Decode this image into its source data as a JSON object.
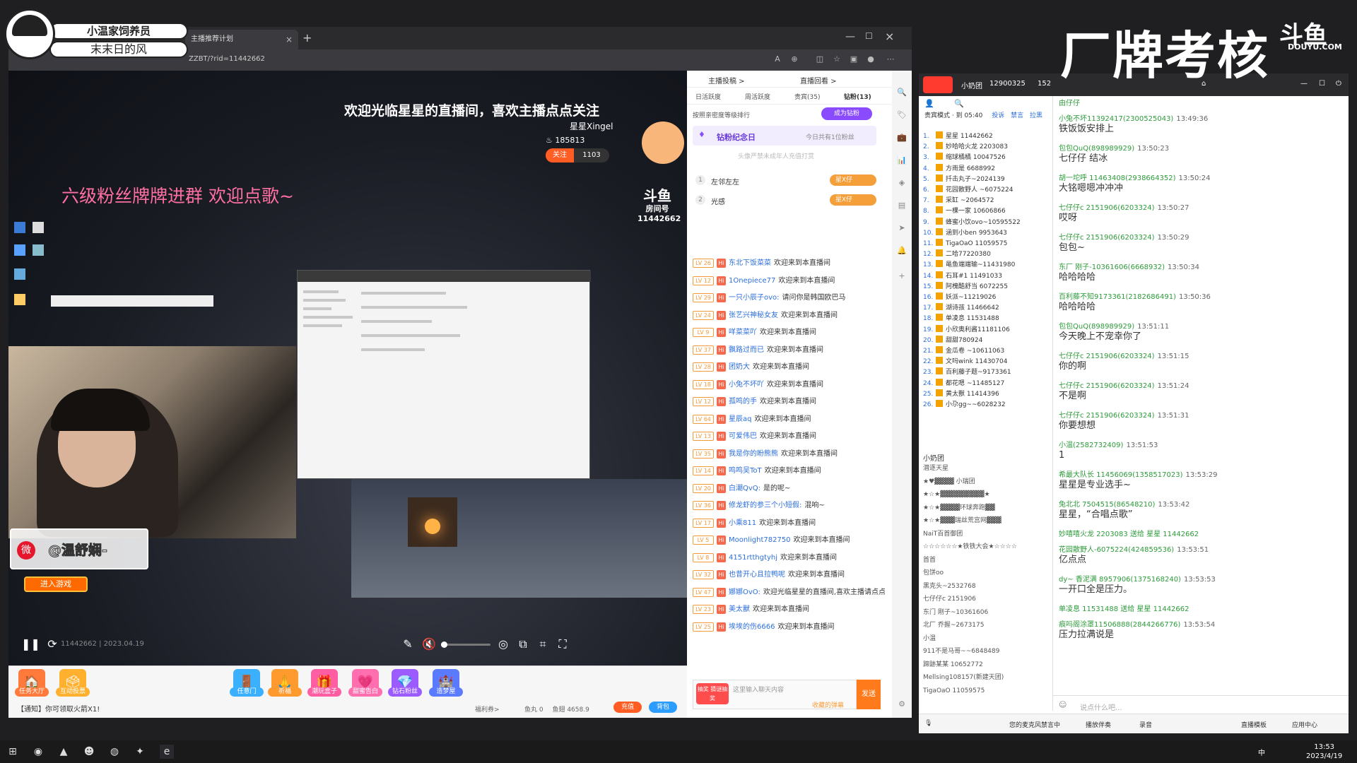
{
  "overlay": {
    "pet_title": "小温家饲养员",
    "pet_subtitle": "末末日的风"
  },
  "watermark": {
    "text": "厂牌考核",
    "site": "DOUYU.COM"
  },
  "browser": {
    "tab_title": "主播推荐计划",
    "url": "ZZBT/?rid=11442662",
    "new_tab": "+"
  },
  "player": {
    "welcome": "欢迎光临星星的直播间，喜欢主播点点关注",
    "anchor_name": "星星Xingel",
    "hot": "185813",
    "follow_label": "关注",
    "follow_count": "1103",
    "fan_text": "六级粉丝牌牌进群 欢迎点歌~",
    "room_logo": "斗鱼",
    "room_label": "房间号",
    "room_id": "11442662",
    "weibo": "@温舒娴-",
    "enter_game": "进入游戏",
    "room_ts": "11442662 | 2023.04.19",
    "volume": 0.05
  },
  "gifts": [
    {
      "name": "任务大厅",
      "icon": "🏠",
      "color": "#ff7a3b"
    },
    {
      "name": "互动投票",
      "icon": "🗳",
      "color": "#ffb02e"
    },
    {
      "name": "任意门",
      "icon": "🚪",
      "color": "#3bb0ff"
    },
    {
      "name": "祈福",
      "icon": "🙏",
      "color": "#ff9a2e"
    },
    {
      "name": "潮玩盒子",
      "icon": "🎁",
      "color": "#ff5fa2"
    },
    {
      "name": "甜蜜告白",
      "icon": "💗",
      "color": "#ff6fb0"
    },
    {
      "name": "钻石粉丝",
      "icon": "💎",
      "color": "#9b5bff"
    },
    {
      "name": "造梦屋",
      "icon": "🏰",
      "color": "#5b7bff"
    }
  ],
  "giftbar": {
    "notice": "【通知】你可领取火箭X1!",
    "welfare": "福利券>",
    "fish_pill": "鱼丸 0",
    "fish_ball": "鱼翅 4658.9",
    "recharge": "充值",
    "bag": "背包"
  },
  "chat": {
    "top_btn1": "主播投稿 >",
    "top_btn2": "直播回看 >",
    "tabs": [
      "日活跃度",
      "周活跃度",
      "贵宾(35)",
      "钻粉(13)"
    ],
    "rank_label": "按照亲密度等级排行",
    "become": "成为钻粉",
    "memorial_title": "钻粉纪念日",
    "memorial_note": "今日共有1位粉丝",
    "hint": "头像严禁未成年人充值打赏",
    "ranks": [
      {
        "no": "1",
        "name": "左邻左左",
        "badge": "星X仔"
      },
      {
        "no": "2",
        "name": "光感",
        "badge": "星X仔"
      }
    ],
    "messages": [
      {
        "lv": "LV 26",
        "user": "东北下饭菜菜",
        "text": "欢迎来到本直播间"
      },
      {
        "lv": "LV 12",
        "user": "1Onepiece77",
        "text": "欢迎来到本直播间"
      },
      {
        "lv": "LV 29",
        "user": "一只小辰子ovo:",
        "text": "请问你是韩国欧巴马"
      },
      {
        "lv": "LV 24",
        "user": "张艺兴神秘女友",
        "text": "欢迎来到本直播间"
      },
      {
        "lv": "LV 9",
        "user": "咩菜菜吖",
        "text": "欢迎来到本直播间"
      },
      {
        "lv": "LV 37",
        "user": "飘路过而已",
        "text": "欢迎来到本直播间"
      },
      {
        "lv": "LV 28",
        "user": "团奶大",
        "text": "欢迎来到本直播间"
      },
      {
        "lv": "LV 18",
        "user": "小兔不坏吖",
        "text": "欢迎来到本直播间"
      },
      {
        "lv": "LV 12",
        "user": "孤鸣的手",
        "text": "欢迎来到本直播间"
      },
      {
        "lv": "LV 64",
        "user": "星辰aq",
        "text": "欢迎来到本直播间"
      },
      {
        "lv": "LV 13",
        "user": "可爱伟巴",
        "text": "欢迎来到本直播间"
      },
      {
        "lv": "LV 35",
        "user": "我是你的盼熊熊",
        "text": "欢迎来到本直播间"
      },
      {
        "lv": "LV 14",
        "user": "鸣鸣吴ToT",
        "text": "欢迎来到本直播间"
      },
      {
        "lv": "LV 20",
        "user": "白潮QvQ:",
        "text": "是的呢~"
      },
      {
        "lv": "LV 36",
        "user": "修龙虾的参三个小短假:",
        "text": "混响~"
      },
      {
        "lv": "LV 17",
        "user": "小乘811",
        "text": "欢迎来到本直播间"
      },
      {
        "lv": "LV 5",
        "user": "Moonlight782750",
        "text": "欢迎来到本直播间"
      },
      {
        "lv": "LV 8",
        "user": "4151rtthgtyhj",
        "text": "欢迎来到本直播间"
      },
      {
        "lv": "LV 32",
        "user": "也昔开心且拉鸭呢",
        "text": "欢迎来到本直播间"
      },
      {
        "lv": "LV 47",
        "user": "娜娜OvO:",
        "text": "欢迎光临星星的直播间,喜欢主播请点点关注~"
      },
      {
        "lv": "LV 23",
        "user": "美太獸",
        "text": "欢迎来到本直播间"
      },
      {
        "lv": "LV 25",
        "user": "埃埃的伤6666",
        "text": "欢迎来到本直播间"
      }
    ],
    "input_placeholder": "这里输入聊天内容",
    "barrage": "收藏的弹幕",
    "send": "发送",
    "lottery": "抽奖 猜谜抽奖"
  },
  "tool": {
    "title": "小奶团",
    "room": "12900325",
    "viewers": "152",
    "users_mode": "贵宾模式 · 到 05:40",
    "users_actions": [
      "投诉",
      "禁言",
      "拉黑"
    ],
    "users": [
      {
        "no": "1.",
        "name": "星星 11442662"
      },
      {
        "no": "2.",
        "name": "妙哈哈火龙 2203083"
      },
      {
        "no": "3.",
        "name": "缩球橘橘 10047526"
      },
      {
        "no": "4.",
        "name": "方雨是 6688992"
      },
      {
        "no": "5.",
        "name": "扦击丸子~2024139"
      },
      {
        "no": "6.",
        "name": "花园散野人 ~6075224"
      },
      {
        "no": "7.",
        "name": "采缸 ~2064572"
      },
      {
        "no": "8.",
        "name": "一棵一家 10606866"
      },
      {
        "no": "9.",
        "name": "蜂蜜小饮ovo~10595522"
      },
      {
        "no": "10.",
        "name": "涵到小ben 9953643"
      },
      {
        "no": "11.",
        "name": "TigaOaO 11059575"
      },
      {
        "no": "12.",
        "name": "二哈77220380"
      },
      {
        "no": "13.",
        "name": "黾鱼端端输~11431980"
      },
      {
        "no": "14.",
        "name": "石耳#1 11491033"
      },
      {
        "no": "15.",
        "name": "阿槐酷舒当 6072255"
      },
      {
        "no": "16.",
        "name": "妖派~11219026"
      },
      {
        "no": "17.",
        "name": "湖诗孩 11466642"
      },
      {
        "no": "18.",
        "name": "单凌息 11531488"
      },
      {
        "no": "19.",
        "name": "小欣奥利酱11181106"
      },
      {
        "no": "20.",
        "name": "甜甜780924"
      },
      {
        "no": "21.",
        "name": "金瓜卷 ~10611063"
      },
      {
        "no": "22.",
        "name": "文吗wink 11430704"
      },
      {
        "no": "23.",
        "name": "百利藤子题~9173361"
      },
      {
        "no": "24.",
        "name": "都花嗯 ~11485127"
      },
      {
        "no": "25.",
        "name": "黄太獸 11414396"
      },
      {
        "no": "26.",
        "name": "小尕gg~~6028232"
      }
    ],
    "fanclub_title": "小奶团",
    "fanclub": [
      "潜逐天星",
      "★♥▓▓▓▓ 小瑞团",
      "★☆★▓▓▓▓▓▓▓▓▓★",
      "★☆★▓▓▓▓环球奔跑▓▓",
      "★☆★▓▓▓瑞丝荒宫网▓▓▓",
      "NaiT百首御团",
      "☆☆☆☆☆☆★铁铁大会★☆☆☆☆",
      "首首",
      "包饼oo",
      "黑克头~2532768",
      "七仔仔c 2151906",
      "东门 刚子~10361606",
      "北厂 乔握~2673175",
      "小温",
      "911不是马哥~~6848489",
      "蹄跡某某 10652772",
      "Mellsing108157(新建天团)",
      "TigaOaO 11059575"
    ],
    "messages": [
      {
        "name": "由仔仔",
        "time": "",
        "text": ""
      },
      {
        "name": "小兔不坏11392417(2300525043)",
        "time": "13:49:36",
        "text": "铁饭饭安排上"
      },
      {
        "name": "包包QuQ(898989929)",
        "time": "13:50:23",
        "text": "七仔仔 结冰"
      },
      {
        "name": "胡一坨呼 11463408(2938664352)",
        "time": "13:50:24",
        "text": "大铭嗯嗯冲冲冲"
      },
      {
        "name": "七仔仔c 2151906(6203324)",
        "time": "13:50:27",
        "text": "哎呀"
      },
      {
        "name": "七仔仔c 2151906(6203324)",
        "time": "13:50:29",
        "text": "包包~"
      },
      {
        "name": "东厂 刚子-10361606(6668932)",
        "time": "13:50:34",
        "text": "哈哈哈哈"
      },
      {
        "name": "百利藤不知9173361(2182686491)",
        "time": "13:50:36",
        "text": "哈哈哈哈"
      },
      {
        "name": "包包QuQ(898989929)",
        "time": "13:51:11",
        "text": "今天晚上不宠幸你了"
      },
      {
        "name": "七仔仔c 2151906(6203324)",
        "time": "13:51:15",
        "text": "你的啊"
      },
      {
        "name": "七仔仔c 2151906(6203324)",
        "time": "13:51:24",
        "text": "不是啊"
      },
      {
        "name": "七仔仔c 2151906(6203324)",
        "time": "13:51:31",
        "text": "你要想想"
      },
      {
        "name": "小温(2582732409)",
        "time": "13:51:53",
        "text": "1"
      },
      {
        "name": "希最大队长 11456069(1358517023)",
        "time": "13:53:29",
        "text": "星星是专业选手~"
      },
      {
        "name": "兔北北 7504515(86548210)",
        "time": "13:53:42",
        "text": "星星，“合唱点歌”"
      },
      {
        "name": "妙嘻嘻火龙 2203083 送给 星星 11442662",
        "time": "",
        "text": ""
      },
      {
        "name": "花园散野人-6075224(424859536)",
        "time": "13:53:51",
        "text": "亿点点"
      },
      {
        "name": "dy~ 香泥满 8957906(1375168240)",
        "time": "13:53:53",
        "text": "一开口全是压力。"
      },
      {
        "name": "单凌息 11531488 送给 星星 11442662",
        "time": "",
        "text": ""
      },
      {
        "name": "痕吗阁涂罩11506888(2844266776)",
        "time": "13:53:54",
        "text": "压力拉满说是"
      }
    ],
    "input_placeholder": "说点什么吧...",
    "bottom": [
      "您的麦克风禁言中",
      "播放伴奏",
      "录音",
      "直播模板",
      "应用中心"
    ]
  },
  "taskbar": {
    "time": "13:53",
    "date": "2023/4/19",
    "ime": "中"
  }
}
